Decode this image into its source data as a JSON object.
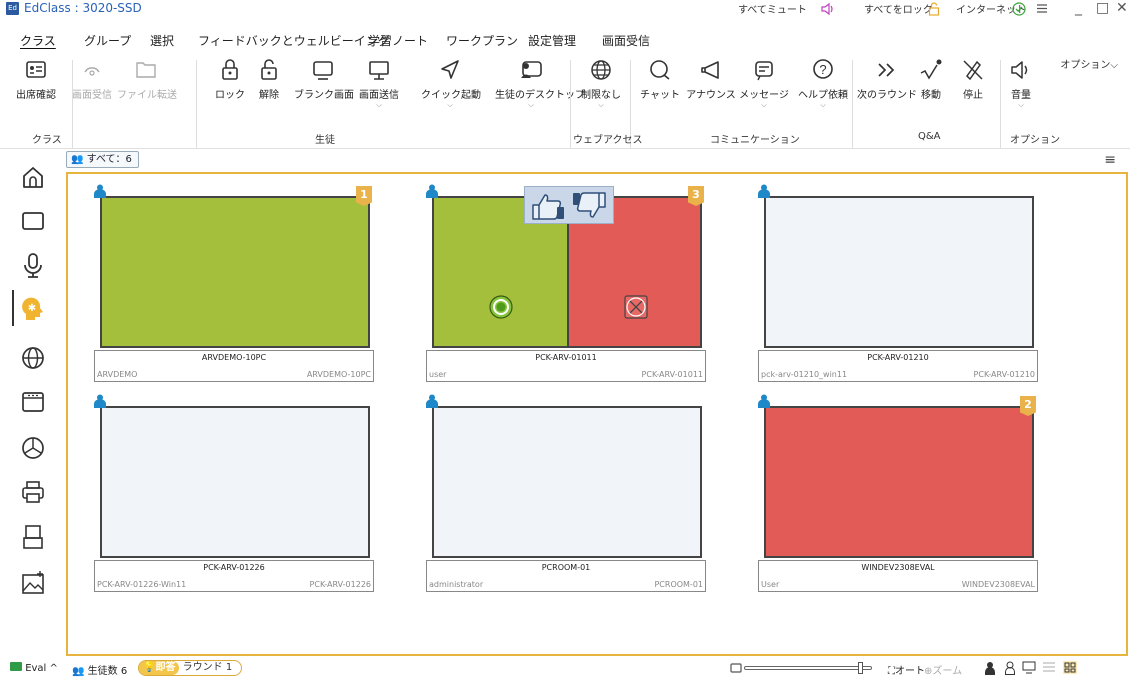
{
  "app": {
    "logo": "Ed",
    "title": "EdClass : 3020-SSD"
  },
  "top_right": {
    "mute_all": "すべてミュート",
    "lock_all": "すべてをロック",
    "internet": "インターネット",
    "options": "オプション",
    "options_caret": "⌵"
  },
  "window": {
    "minimize": "_",
    "maximize": "□",
    "close": "✕"
  },
  "menu": [
    {
      "label": "クラス",
      "active": true
    },
    {
      "label": "グループ"
    },
    {
      "label": "選択"
    },
    {
      "label": "フィードバックとウェルビーイング"
    },
    {
      "label": "学習ノート"
    },
    {
      "label": "ワークプラン"
    },
    {
      "label": "設定管理"
    },
    {
      "label": "画面受信"
    }
  ],
  "ribbon": {
    "tools": [
      {
        "label": "出席確認",
        "icon": "attendance-icon"
      },
      {
        "label": "画面受信",
        "icon": "screen-receive-icon",
        "disabled": true
      },
      {
        "label": "ファイル転送",
        "icon": "file-transfer-icon",
        "disabled": true
      },
      {
        "label": "ロック",
        "icon": "lock-icon"
      },
      {
        "label": "解除",
        "icon": "unlock-icon"
      },
      {
        "label": "ブランク画面",
        "icon": "blank-screen-icon"
      },
      {
        "label": "画面送信",
        "icon": "screen-send-icon",
        "caret": "⌵"
      },
      {
        "label": "クイック起動",
        "icon": "quick-launch-icon",
        "caret": "⌵"
      },
      {
        "label": "生徒のデスクトップ",
        "icon": "student-desktop-icon",
        "caret": "⌵"
      },
      {
        "label": "制限なし",
        "icon": "globe-icon",
        "caret": "⌵"
      },
      {
        "label": "チャット",
        "icon": "chat-icon"
      },
      {
        "label": "アナウンス",
        "icon": "announce-icon"
      },
      {
        "label": "メッセージ",
        "icon": "message-icon",
        "caret": "⌵"
      },
      {
        "label": "ヘルプ依頼",
        "icon": "help-icon",
        "caret": "⌵"
      },
      {
        "label": "次のラウンド",
        "icon": "next-round-icon"
      },
      {
        "label": "移動",
        "icon": "move-icon"
      },
      {
        "label": "停止",
        "icon": "stop-icon"
      },
      {
        "label": "音量",
        "icon": "volume-icon",
        "caret": "⌵"
      }
    ],
    "groups": [
      "クラス",
      "生徒",
      "ウェブアクセス",
      "コミュニケーション",
      "Q&A",
      "オプション"
    ]
  },
  "filter_chip": "すべて：6",
  "students": [
    {
      "pc": "ARVDEMO-10PC",
      "user": "ARVDEMO",
      "pc_right": "ARVDEMO-10PC",
      "badge": "1",
      "state": "green"
    },
    {
      "pc": "PCK-ARV-01011",
      "user": "user",
      "pc_right": "PCK-ARV-01011",
      "badge": "3",
      "state": "split"
    },
    {
      "pc": "PCK-ARV-01210",
      "user": "pck-arv-01210_win11",
      "pc_right": "PCK-ARV-01210",
      "badge": "",
      "state": "blank"
    },
    {
      "pc": "PCK-ARV-01226",
      "user": "PCK-ARV-01226-Win11",
      "pc_right": "PCK-ARV-01226",
      "badge": "",
      "state": "blank"
    },
    {
      "pc": "PCROOM-01",
      "user": "administrator",
      "pc_right": "PCROOM-01",
      "badge": "",
      "state": "blank"
    },
    {
      "pc": "WINDEV2308EVAL",
      "user": "User",
      "pc_right": "WINDEV2308EVAL",
      "badge": "2",
      "state": "red"
    }
  ],
  "status": {
    "eval": "Eval",
    "eval_caret": "^",
    "student_count": "生徒数 6",
    "instant": "即答",
    "round": "ラウンド 1",
    "auto": "オート",
    "zoom": "ズーム"
  },
  "colors": {
    "green": "#a4bf3b",
    "red": "#e35b57",
    "blank": "#f1f4f8",
    "accent": "#e7b43e",
    "title_blue": "#2a62b8",
    "user_icon": "#1e88c8"
  },
  "zoom_level": 0.94
}
